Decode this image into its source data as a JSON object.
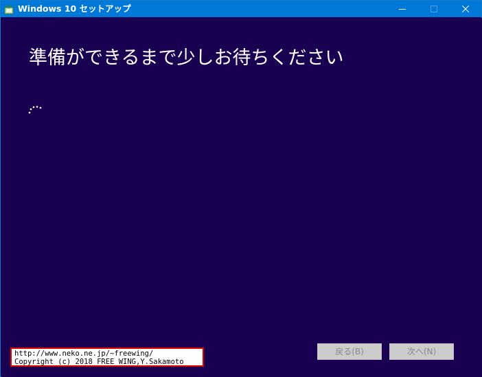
{
  "window": {
    "title": "Windows 10 セットアップ",
    "icon": "setup-app-icon",
    "controls": [
      "minimize-icon",
      "maximize-icon",
      "close-icon"
    ]
  },
  "main": {
    "heading": "準備ができるまで少しお待ちください",
    "spinner_icon": "loading-dots-icon"
  },
  "footer": {
    "back_label": "戻る(B)",
    "next_label": "次へ(N)"
  },
  "credit": {
    "line1": "http://www.neko.ne.jp/~freewing/",
    "line2": "Copyright (c) 2018 FREE WING,Y.Sakamoto"
  },
  "colors": {
    "titlebar": "#0078d7",
    "background": "#1a0050",
    "button_disabled": "#cccccc",
    "credit_border": "#e00000"
  }
}
